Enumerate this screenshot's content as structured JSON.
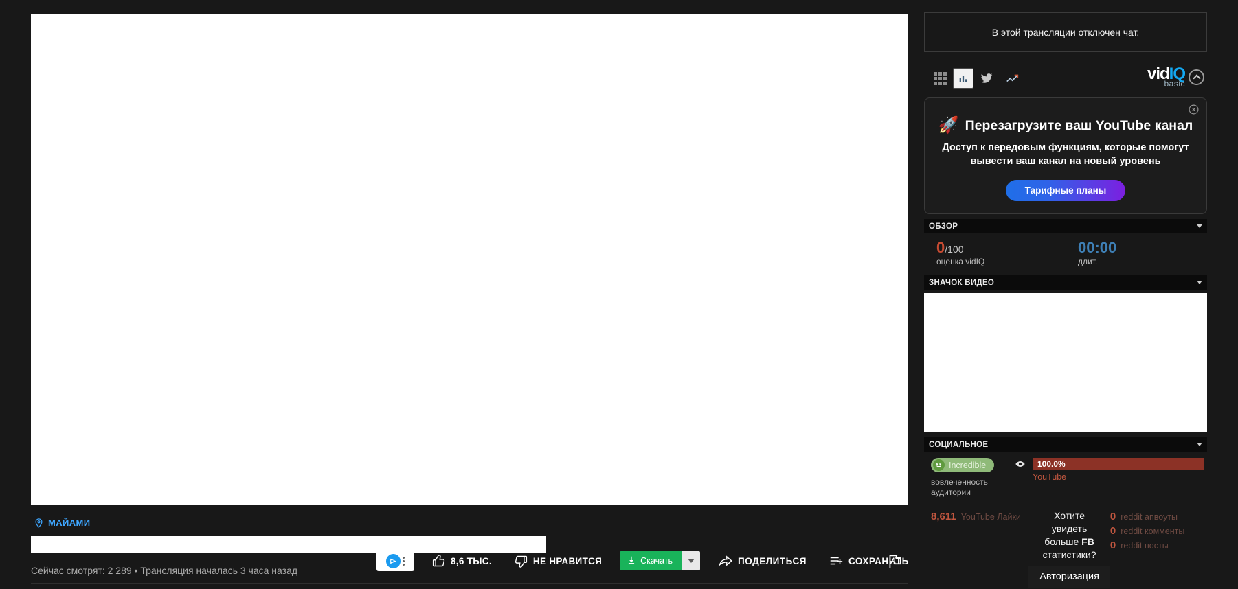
{
  "player": {
    "location_label": "МАЙАМИ",
    "location_icon": "location-pin-icon",
    "meta_text": "Сейчас смотрят: 2 289 • Трансляция началась 3 часа назад",
    "vidiq_badge_icon": "vidiq-play-icon",
    "kebab_icon": "kebab-menu-icon"
  },
  "actions": {
    "like": {
      "icon": "thumbs-up-icon",
      "label": "8,6 ТЫС."
    },
    "dislike": {
      "icon": "thumbs-down-icon",
      "label": "НЕ НРАВИТСЯ"
    },
    "download": {
      "icon": "download-arrow-icon",
      "label": "Скачать",
      "dropdown_icon": "caret-down-icon"
    },
    "share": {
      "icon": "share-arrow-icon",
      "label": "ПОДЕЛИТЬСЯ"
    },
    "save": {
      "icon": "save-playlist-icon",
      "label": "СОХРАНИТЬ"
    },
    "report": {
      "icon": "flag-icon"
    }
  },
  "sidebar": {
    "chat_disabled": "В этой трансляции отключен чат.",
    "toolbar": {
      "icons": [
        {
          "name": "grid-icon",
          "active": false
        },
        {
          "name": "bar-chart-icon",
          "active": true
        },
        {
          "name": "twitter-icon",
          "active": false
        },
        {
          "name": "trending-up-icon",
          "active": false
        }
      ],
      "brand_vid": "vid",
      "brand_iq": "IQ",
      "brand_tier": "basic",
      "collapse_icon": "chevron-up-circle-icon"
    },
    "promo": {
      "close_icon": "close-circle-icon",
      "rocket_icon": "rocket-icon",
      "title": "Перезагрузите ваш YouTube канал",
      "subtitle": "Доступ к передовым функциям, которые помогут вывести ваш канал на новый уровень",
      "cta": "Тарифные планы"
    },
    "overview": {
      "header": "ОБЗОР",
      "score_value": "0",
      "score_denominator": "/100",
      "score_label": "оценка vidIQ",
      "duration_value": "00:00",
      "duration_label": "длит."
    },
    "thumbnail": {
      "header": "ЗНАЧОК ВИДЕО"
    },
    "social": {
      "header": "СОЦИАЛЬНОЕ",
      "engagement_badge": "Incredible",
      "engagement_face_icon": "laughing-face-icon",
      "engagement_label": "вовлеченность аудитории",
      "eye_icon": "eye-icon",
      "bar_percent": "100.0%",
      "bar_label": "YouTube",
      "youtube_likes_value": "8,611",
      "youtube_likes_label": "YouTube Лайки",
      "fb_question_line1": "Хотите",
      "fb_question_line2": "увидеть",
      "fb_question_line3_pre": "больше ",
      "fb_question_line3_bold": "FB",
      "fb_question_line4": "статистики?",
      "fb_button": "Авторизация",
      "reddit": [
        {
          "value": "0",
          "label": "reddit апвоуты"
        },
        {
          "value": "0",
          "label": "reddit комменты"
        },
        {
          "value": "0",
          "label": "reddit посты"
        }
      ]
    }
  },
  "colors": {
    "page_bg": "#181818",
    "accent_blue": "#3ea6ff",
    "vidiq_blue": "#13a9f3",
    "download_green": "#19b35a",
    "score_red": "#c74b32",
    "bar_red": "#8c3226",
    "badge_green": "#8fba79"
  }
}
